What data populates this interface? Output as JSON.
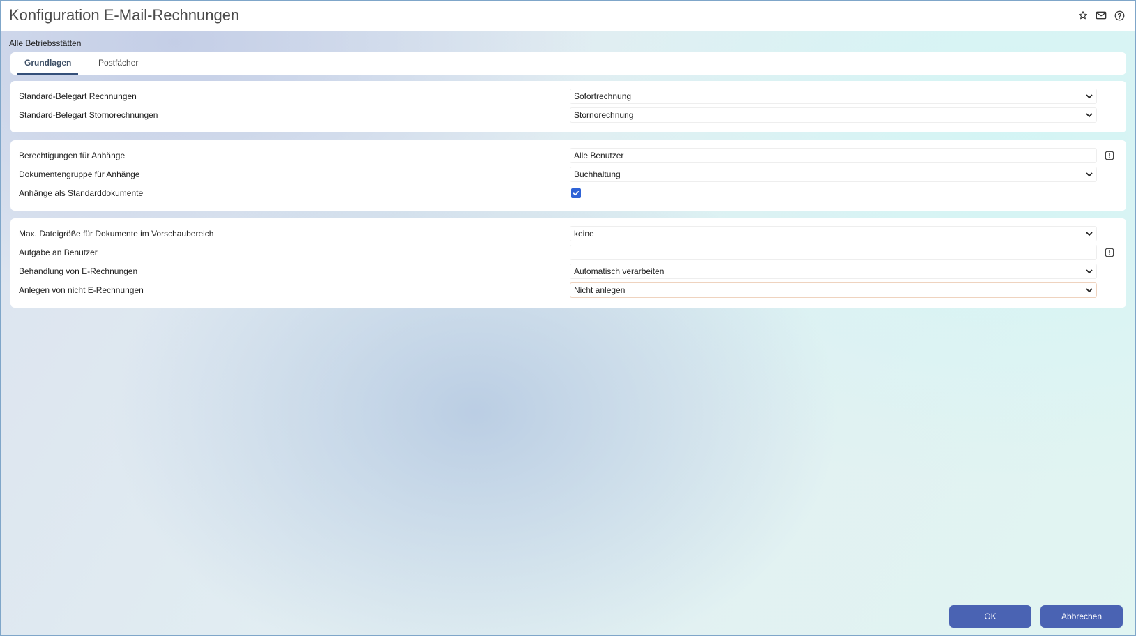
{
  "header": {
    "title": "Konfiguration E-Mail-Rechnungen",
    "icons": [
      "star-icon",
      "mail-icon",
      "help-icon"
    ]
  },
  "scope_label": "Alle Betriebsstätten",
  "tabs": [
    {
      "label": "Grundlagen",
      "active": true
    },
    {
      "label": "Postfächer",
      "active": false
    }
  ],
  "section1": {
    "invoice_type_label": "Standard-Belegart Rechnungen",
    "invoice_type_value": "Sofortrechnung",
    "cancel_type_label": "Standard-Belegart Stornorechnungen",
    "cancel_type_value": "Stornorechnung"
  },
  "section2": {
    "permissions_label": "Berechtigungen für Anhänge",
    "permissions_value": "Alle Benutzer",
    "docgroup_label": "Dokumentengruppe für Anhänge",
    "docgroup_value": "Buchhaltung",
    "standard_docs_label": "Anhänge als Standarddokumente",
    "standard_docs_checked": true
  },
  "section3": {
    "max_size_label": "Max. Dateigröße für Dokumente im Vorschaubereich",
    "max_size_value": "keine",
    "task_user_label": "Aufgabe an Benutzer",
    "task_user_value": "",
    "einvoice_label": "Behandlung von E-Rechnungen",
    "einvoice_value": "Automatisch verarbeiten",
    "non_einvoice_label": "Anlegen von nicht E-Rechnungen",
    "non_einvoice_value": "Nicht anlegen"
  },
  "footer": {
    "ok_label": "OK",
    "cancel_label": "Abbrechen"
  },
  "colors": {
    "primary_button": "#4a63b3",
    "checkbox": "#2f63d6",
    "tab_active": "#35507a"
  }
}
